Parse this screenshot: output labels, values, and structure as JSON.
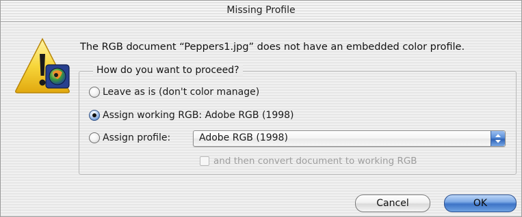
{
  "window": {
    "title": "Missing Profile"
  },
  "icons": {
    "alert": "warning-triangle-icon",
    "badge": "colorsync-badge-icon",
    "popup_arrows": "chevron-updown-icon"
  },
  "message": "The RGB document “Peppers1.jpg” does not have an embedded color profile.",
  "options": {
    "legend": "How do you want to proceed?",
    "leave": {
      "label": "Leave as is (don't color manage)",
      "selected": false
    },
    "assign_working": {
      "label": "Assign working RGB:  Adobe RGB (1998)",
      "selected": true
    },
    "assign_profile": {
      "label": "Assign profile:",
      "selected": false,
      "profile_value": "Adobe RGB (1998)"
    },
    "convert": {
      "label": "and then convert document to working RGB",
      "checked": false,
      "enabled": false
    }
  },
  "buttons": {
    "cancel": "Cancel",
    "ok": "OK"
  },
  "colors": {
    "default_button": "#3e74c7",
    "alert_yellow": "#f3c21a"
  }
}
